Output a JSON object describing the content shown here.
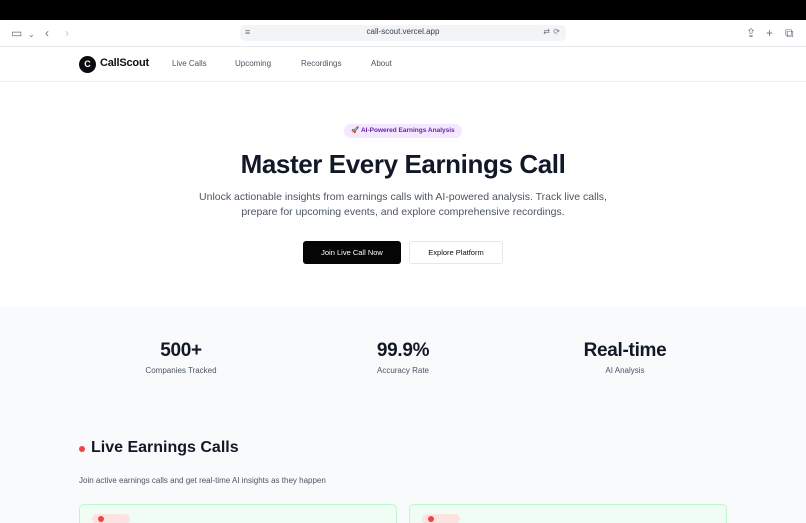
{
  "browser": {
    "url": "call-scout.vercel.app",
    "icons": [
      "sidebar-icon",
      "chevron-down-icon",
      "back-icon",
      "forward-icon",
      "page-menu-icon",
      "translate-icon",
      "reload-icon",
      "share-icon",
      "new-tab-icon",
      "tabs-icon"
    ]
  },
  "nav": {
    "logo_letter": "C",
    "brand": "CallScout",
    "links": [
      "Live Calls",
      "Upcoming",
      "Recordings",
      "About"
    ]
  },
  "hero": {
    "badge": "🚀 AI-Powered Earnings Analysis",
    "title": "Master Every Earnings Call",
    "subtitle": "Unlock actionable insights from earnings calls with AI-powered analysis. Track live calls, prepare for upcoming events, and explore comprehensive recordings.",
    "primary_button": "Join Live Call Now",
    "secondary_button": "Explore Platform"
  },
  "stats": [
    {
      "value": "500+",
      "label": "Companies Tracked"
    },
    {
      "value": "99.9%",
      "label": "Accuracy Rate"
    },
    {
      "value": "Real-time",
      "label": "AI Analysis"
    }
  ],
  "live": {
    "title": "Live Earnings Calls",
    "subtitle": "Join active earnings calls and get real-time AI insights as they happen"
  },
  "colors": {
    "accent": "#050505",
    "live_red": "#ef4444",
    "badge_bg": "#f3e8ff",
    "badge_text": "#6b21a8",
    "card_bg": "#f0fdf4"
  }
}
